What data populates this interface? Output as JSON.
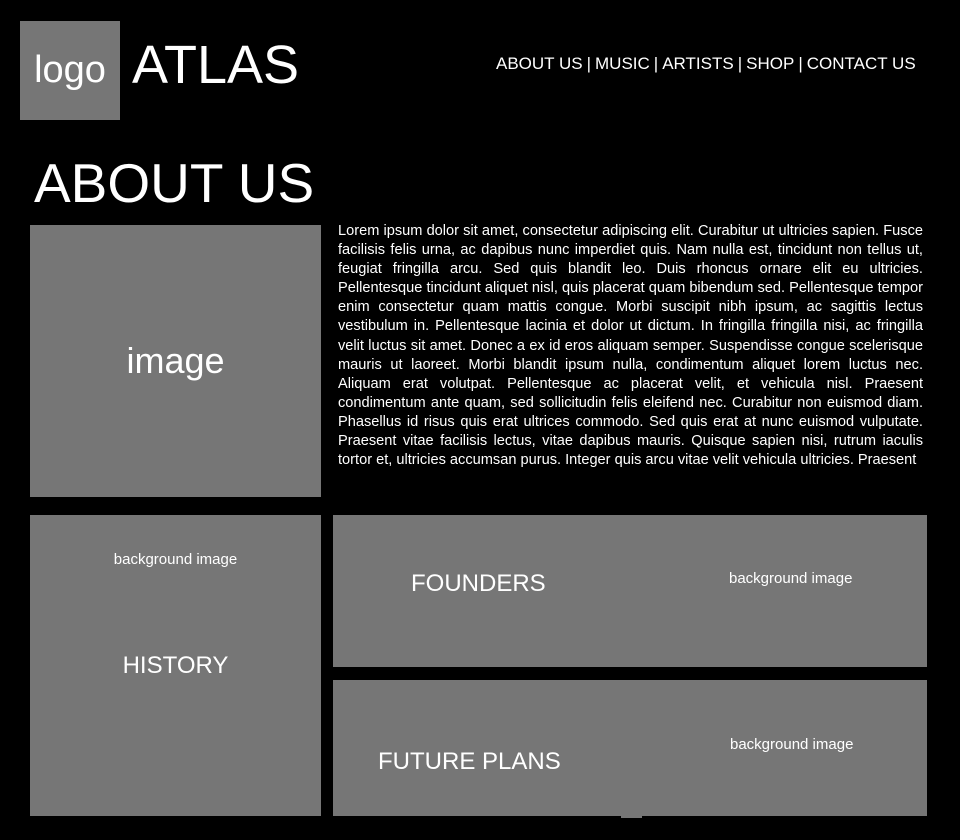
{
  "header": {
    "logo_text": "logo",
    "site_title": "ATLAS",
    "nav": [
      {
        "label": "ABOUT US"
      },
      {
        "label": "MUSIC"
      },
      {
        "label": "ARTISTS"
      },
      {
        "label": "SHOP"
      },
      {
        "label": "CONTACT US"
      }
    ],
    "nav_separator": "|"
  },
  "main": {
    "page_title": "ABOUT US",
    "image_placeholder": "image",
    "about_text": "Lorem ipsum dolor sit amet, consectetur adipiscing elit. Curabitur ut ultricies sapien. Fusce facilisis felis urna, ac dapibus nunc imperdiet quis. Nam nulla est, tincidunt non tellus ut, feugiat fringilla arcu. Sed quis blandit leo. Duis rhoncus ornare elit eu ultricies. Pellentesque tincidunt aliquet nisl, quis placerat quam bibendum sed. Pellentesque tempor enim consectetur quam mattis congue. Morbi suscipit nibh ipsum, ac sagittis lectus vestibulum in. Pellentesque lacinia et dolor ut dictum. In fringilla fringilla nisi, ac fringilla velit luctus sit amet. Donec a ex id eros aliquam semper. Suspendisse congue scelerisque mauris ut laoreet. Morbi blandit ipsum nulla, condimentum aliquet lorem luctus nec. Aliquam erat volutpat. Pellentesque ac placerat velit, et vehicula nisl. Praesent condimentum ante quam, sed sollicitudin felis eleifend nec. Curabitur non euismod diam. Phasellus id risus quis erat ultrices commodo. Sed quis erat at nunc euismod vulputate. Praesent vitae facilisis lectus, vitae dapibus mauris. Quisque sapien nisi, rutrum iaculis tortor et, ultricies accumsan purus. Integer quis arcu vitae velit vehicula ultricies. Praesent"
  },
  "tiles": {
    "history": {
      "label": "HISTORY",
      "bg_note": "background image"
    },
    "founders": {
      "label": "FOUNDERS",
      "bg_note": "background image"
    },
    "future": {
      "label": "FUTURE PLANS",
      "bg_note": "background image"
    }
  },
  "colors": {
    "background": "#000000",
    "placeholder_gray": "#767676",
    "text": "#ffffff"
  }
}
